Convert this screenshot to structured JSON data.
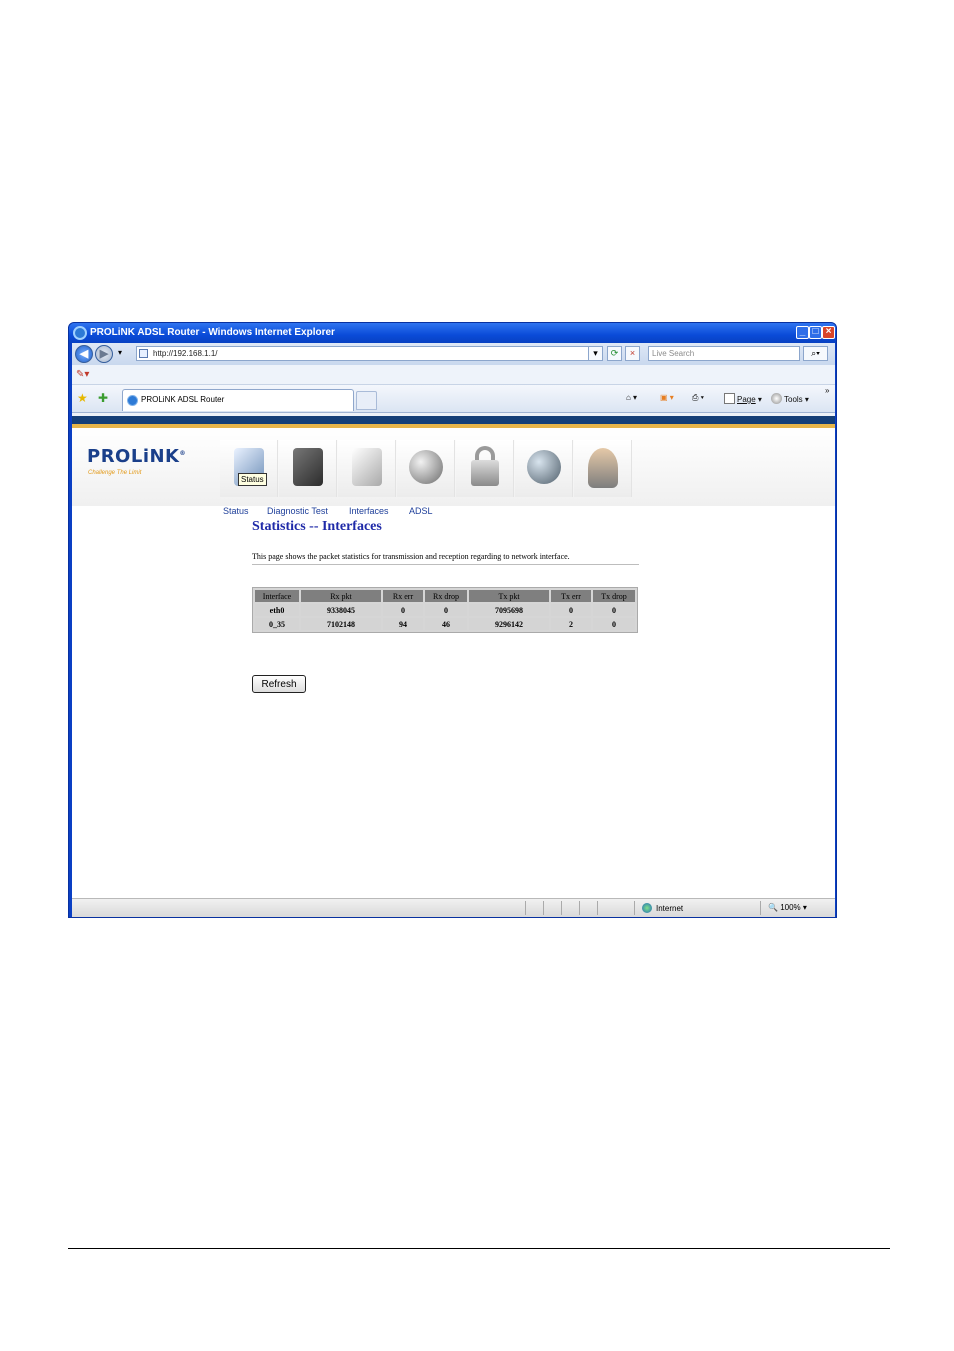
{
  "window": {
    "title": "PROLiNK ADSL Router - Windows Internet Explorer"
  },
  "address_bar": {
    "url": "http://192.168.1.1/",
    "search_placeholder": "Live Search"
  },
  "tab": {
    "label": "PROLiNK ADSL Router"
  },
  "toolbar": {
    "page_label": "Page",
    "tools_label": "Tools",
    "overflow": "»"
  },
  "router": {
    "logo": "PROLiNK",
    "logo_mark": "®",
    "tagline": "Challenge The Limit",
    "tooltip": "Status",
    "nav_icons": [
      "status-icon",
      "gear-icon",
      "device-icon",
      "globe-icon",
      "lock-icon",
      "network-icon",
      "user-icon"
    ],
    "submenu": [
      "Status",
      "Diagnostic Test",
      "Interfaces",
      "ADSL"
    ]
  },
  "main": {
    "title": "Statistics -- Interfaces",
    "description": "This page shows the packet statistics for transmission and reception regarding to network interface.",
    "table": {
      "headers": [
        "Interface",
        "Rx pkt",
        "Rx err",
        "Rx drop",
        "Tx pkt",
        "Tx err",
        "Tx drop"
      ],
      "rows": [
        [
          "eth0",
          "9338045",
          "0",
          "0",
          "7095698",
          "0",
          "0"
        ],
        [
          "0_35",
          "7102148",
          "94",
          "46",
          "9296142",
          "2",
          "0"
        ]
      ]
    },
    "refresh_label": "Refresh"
  },
  "statusbar": {
    "zone": "Internet",
    "zoom": "100%"
  },
  "colors": {
    "title_blue": "#1f2aa8",
    "brand_blue": "#1a3f8a",
    "accent_orange": "#e7b54a"
  }
}
